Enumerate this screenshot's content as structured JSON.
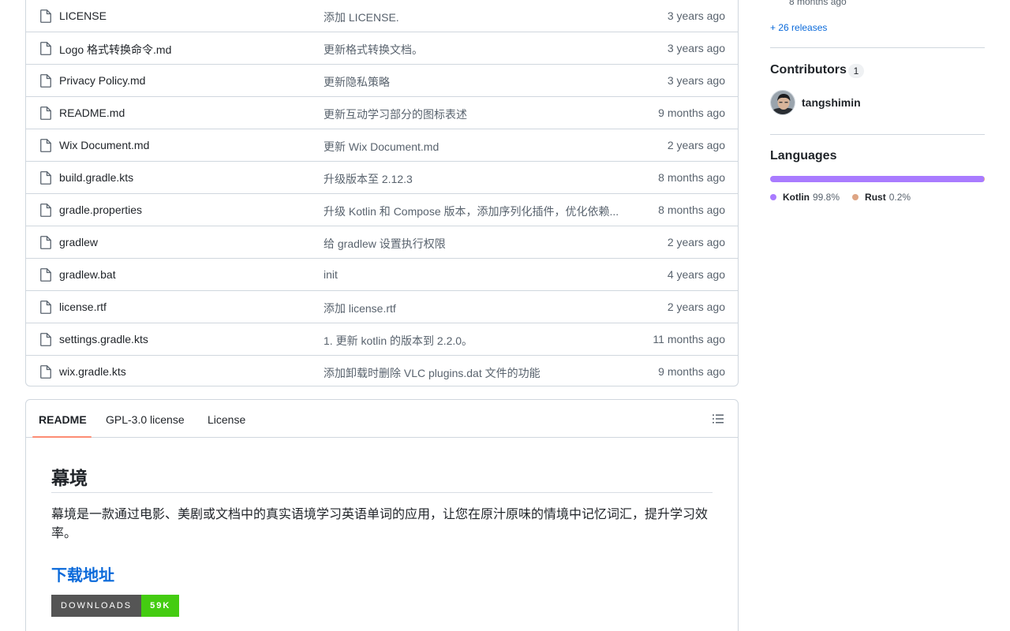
{
  "files": [
    {
      "name": "LICENSE",
      "message": "添加 LICENSE.",
      "date": "3 years ago"
    },
    {
      "name": "Logo 格式转换命令.md",
      "message": "更新格式转换文档。",
      "date": "3 years ago"
    },
    {
      "name": "Privacy Policy.md",
      "message": "更新隐私策略",
      "date": "3 years ago"
    },
    {
      "name": "README.md",
      "message": "更新互动学习部分的图标表述",
      "date": "9 months ago"
    },
    {
      "name": "Wix Document.md",
      "message": "更新 Wix Document.md",
      "date": "2 years ago"
    },
    {
      "name": "build.gradle.kts",
      "message": "升级版本至 2.12.3",
      "date": "8 months ago"
    },
    {
      "name": "gradle.properties",
      "message": "升级 Kotlin 和 Compose 版本，添加序列化插件，优化依赖...",
      "date": "8 months ago"
    },
    {
      "name": "gradlew",
      "message": "给 gradlew 设置执行权限",
      "date": "2 years ago"
    },
    {
      "name": "gradlew.bat",
      "message": "init",
      "date": "4 years ago"
    },
    {
      "name": "license.rtf",
      "message": "添加 license.rtf",
      "date": "2 years ago"
    },
    {
      "name": "settings.gradle.kts",
      "message": "1. 更新 kotlin 的版本到 2.2.0。",
      "date": "11 months ago"
    },
    {
      "name": "wix.gradle.kts",
      "message": "添加卸载时删除 VLC plugins.dat 文件的功能",
      "date": "9 months ago"
    }
  ],
  "readme": {
    "tabs": [
      "README",
      "GPL-3.0 license",
      "License"
    ],
    "title": "幕境",
    "description": "幕境是一款通过电影、美剧或文档中的真实语境学习英语单词的应用，让您在原汁原味的情境中记忆词汇，提升学习效率。",
    "download_heading": "下载地址",
    "badge_label": "DOWNLOADS",
    "badge_value": "59K"
  },
  "sidebar": {
    "release_date": "8 months ago",
    "releases_link": "+ 26 releases",
    "contributors_heading": "Contributors",
    "contributors_count": "1",
    "contributor_name": "tangshimin",
    "languages_heading": "Languages",
    "languages": [
      {
        "name": "Kotlin",
        "percent": "99.8%",
        "value": 99.8,
        "color": "#A97BFF"
      },
      {
        "name": "Rust",
        "percent": "0.2%",
        "value": 0.2,
        "color": "#DEA584"
      }
    ]
  }
}
